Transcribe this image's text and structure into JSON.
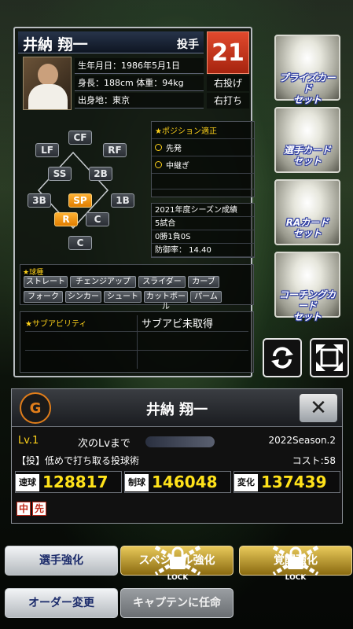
{
  "player": {
    "name": "井納 翔一",
    "position": "投手",
    "number": "21",
    "birth": "生年月日：1986年5月1日",
    "body": "身長：188cm 体重：94kg",
    "birthplace": "出身地：東京",
    "throws": "右投げ",
    "bats": "右打ち"
  },
  "field_positions": [
    {
      "label": "CF",
      "on": false
    },
    {
      "label": "LF",
      "on": false
    },
    {
      "label": "RF",
      "on": false
    },
    {
      "label": "SS",
      "on": false
    },
    {
      "label": "2B",
      "on": false
    },
    {
      "label": "3B",
      "on": false
    },
    {
      "label": "SP",
      "on": true
    },
    {
      "label": "1B",
      "on": false
    },
    {
      "label": "R",
      "on": true
    },
    {
      "label": "C",
      "on": false
    },
    {
      "label": "C",
      "on": false
    }
  ],
  "position_aptitude": {
    "title": "★ポジション適正",
    "options": [
      "先発",
      "中継ぎ"
    ]
  },
  "season": {
    "title": "2021年度シーズン成績",
    "games": "5試合",
    "record": "0勝1負0S",
    "era": "防御率： 14.40"
  },
  "pitch_types": {
    "title": "★球種",
    "items": [
      "ストレート",
      "チェンジアップ",
      "スライダー",
      "カーブ",
      "フォーク",
      "シンカー",
      "シュート",
      "カットボール",
      "パーム"
    ]
  },
  "sub_ability": {
    "title": "★サブアビリティ",
    "value": "サブアビ未取得"
  },
  "side_buttons": [
    {
      "label": "プライズカード\nセット"
    },
    {
      "label": "選手カード\nセット"
    },
    {
      "label": "RAカード\nセット"
    },
    {
      "label": "コーチングカード\nセット"
    }
  ],
  "detail": {
    "name": "井納 翔一",
    "logo": "G",
    "level": "Lv.1",
    "next_level": "次のLvまで",
    "season": "2022Season.2",
    "skill": "【投】低めで打ち取る投球術",
    "cost": "コスト:58",
    "stats": [
      {
        "label": "速球",
        "value": "128817"
      },
      {
        "label": "制球",
        "value": "146048"
      },
      {
        "label": "変化",
        "value": "137439"
      }
    ],
    "tags": [
      "中",
      "先"
    ]
  },
  "bottom_buttons": [
    {
      "label": "選手強化",
      "locked": false
    },
    {
      "label": "スペシャル強化",
      "locked": true
    },
    {
      "label": "覚醒強化",
      "locked": true
    },
    {
      "label": "オーダー変更",
      "locked": false
    },
    {
      "label": "キャプテンに任命",
      "locked": false
    }
  ],
  "lock_label": "LOCK"
}
